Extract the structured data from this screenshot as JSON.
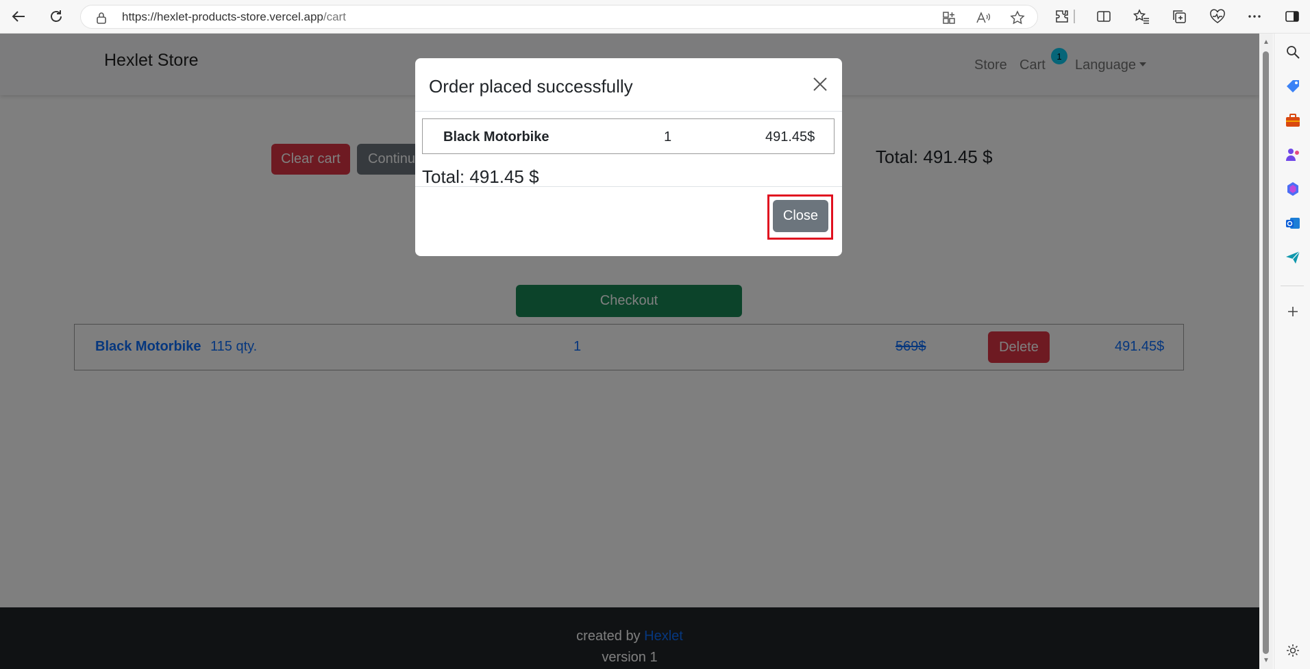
{
  "browser": {
    "url_host": "https://hexlet-products-store.vercel.app",
    "url_path": "/cart"
  },
  "site": {
    "brand": "Hexlet Store",
    "nav": {
      "store": "Store",
      "cart": "Cart",
      "cart_count": "1",
      "language": "Language"
    }
  },
  "cart": {
    "clear_button": "Clear cart",
    "continue_button": "Continue",
    "total": "Total: 491.45 $",
    "checkout_button": "Checkout",
    "items": [
      {
        "name": "Black Motorbike",
        "stock": "115 qty.",
        "quantity": "1",
        "old_price": "569$",
        "delete_button": "Delete",
        "price": "491.45$"
      }
    ]
  },
  "modal": {
    "title": "Order placed successfully",
    "items": [
      {
        "name": "Black Motorbike",
        "quantity": "1",
        "price": "491.45$"
      }
    ],
    "total": "Total: 491.45 $",
    "close_button": "Close"
  },
  "footer": {
    "created_by": "created by",
    "author_link": "Hexlet",
    "version": "version 1"
  },
  "colors": {
    "danger": "#dc3545",
    "secondary": "#6c757d",
    "success": "#198754",
    "link": "#0d6efd",
    "highlight": "#e0101f"
  }
}
